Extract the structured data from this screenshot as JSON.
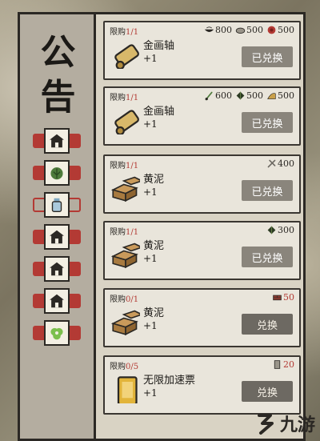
{
  "board": {
    "title_chars": [
      "公",
      "告"
    ]
  },
  "tabs": [
    {
      "icon": "house-icon",
      "active": true
    },
    {
      "icon": "bush-icon",
      "active": true
    },
    {
      "icon": "bottle-icon",
      "active": false
    },
    {
      "icon": "house-icon",
      "active": true
    },
    {
      "icon": "house-icon",
      "active": true
    },
    {
      "icon": "house-icon",
      "active": true
    },
    {
      "icon": "flower-icon",
      "active": true
    }
  ],
  "items": [
    {
      "limit_label": "限购",
      "limit_count": "1/1",
      "name": "金画轴",
      "qty": "+1",
      "item_icon": "scroll-icon",
      "costs": [
        {
          "icon": "bowl-icon",
          "value": "800",
          "red": false
        },
        {
          "icon": "stone-icon",
          "value": "500",
          "red": false
        },
        {
          "icon": "rose-icon",
          "value": "500",
          "red": false
        }
      ],
      "button": "已兑换",
      "redeemed": true
    },
    {
      "limit_label": "限购",
      "limit_count": "1/1",
      "name": "金画轴",
      "qty": "+1",
      "item_icon": "scroll-icon",
      "costs": [
        {
          "icon": "brush-icon",
          "value": "600",
          "red": false
        },
        {
          "icon": "leaf-icon",
          "value": "500",
          "red": false
        },
        {
          "icon": "hay-icon",
          "value": "500",
          "red": false
        }
      ],
      "button": "已兑换",
      "redeemed": true
    },
    {
      "limit_label": "限购",
      "limit_count": "1/1",
      "name": "黄泥",
      "qty": "+1",
      "item_icon": "mud-bricks-icon",
      "costs": [
        {
          "icon": "tool-icon",
          "value": "400",
          "red": false
        }
      ],
      "button": "已兑换",
      "redeemed": true
    },
    {
      "limit_label": "限购",
      "limit_count": "1/1",
      "name": "黄泥",
      "qty": "+1",
      "item_icon": "mud-bricks-icon",
      "costs": [
        {
          "icon": "leaf-icon",
          "value": "300",
          "red": false
        }
      ],
      "button": "已兑换",
      "redeemed": true
    },
    {
      "limit_label": "限购",
      "limit_count": "0/1",
      "name": "黄泥",
      "qty": "+1",
      "item_icon": "mud-bricks-icon",
      "costs": [
        {
          "icon": "brick-icon",
          "value": "50",
          "red": true
        }
      ],
      "button": "兑换",
      "redeemed": false
    },
    {
      "limit_label": "限购",
      "limit_count": "0/5",
      "name": "无限加速票",
      "qty": "+1",
      "item_icon": "ticket-icon",
      "costs": [
        {
          "icon": "ticket-small-icon",
          "value": "20",
          "red": true
        }
      ],
      "button": "兑换",
      "redeemed": false
    }
  ],
  "watermark": {
    "text": "九游"
  },
  "colors": {
    "accent_red": "#b33a34",
    "ink": "#1b1916",
    "paper": "#e9e5db"
  }
}
